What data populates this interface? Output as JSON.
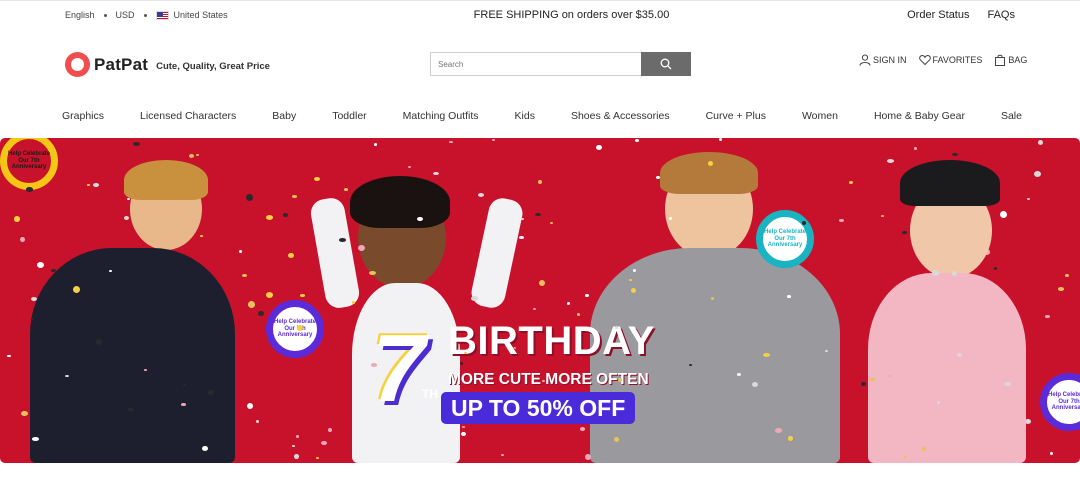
{
  "topbar": {
    "language": "English",
    "currency": "USD",
    "country": "United States",
    "shipping": "FREE SHIPPING on orders over $35.00",
    "order_status": "Order Status",
    "faqs": "FAQs"
  },
  "header": {
    "brand": "PatPat",
    "tagline": "Cute, Quality, Great Price",
    "search_placeholder": "Search",
    "sign_in": "SIGN IN",
    "favorites": "FAVORITES",
    "bag": "BAG"
  },
  "nav": {
    "items": [
      "Graphics",
      "Licensed Characters",
      "Baby",
      "Toddler",
      "Matching Outfits",
      "Kids",
      "Shoes & Accessories",
      "Curve + Plus",
      "Women",
      "Home & Baby Gear",
      "Sale"
    ]
  },
  "banner": {
    "number": "7",
    "suffix": "TH",
    "headline": "BIRTHDAY",
    "subline": "MORE CUTE MORE OFTEN",
    "offer": "UP TO 50% OFF",
    "badge_text": "Help Celebrate Our 7th Anniversary",
    "colors": {
      "background": "#c8112a",
      "accent": "#4a2bd9",
      "badge_yellow": "#f5c518",
      "badge_teal": "#19b3c2",
      "badge_purple": "#5b2bd9"
    }
  }
}
